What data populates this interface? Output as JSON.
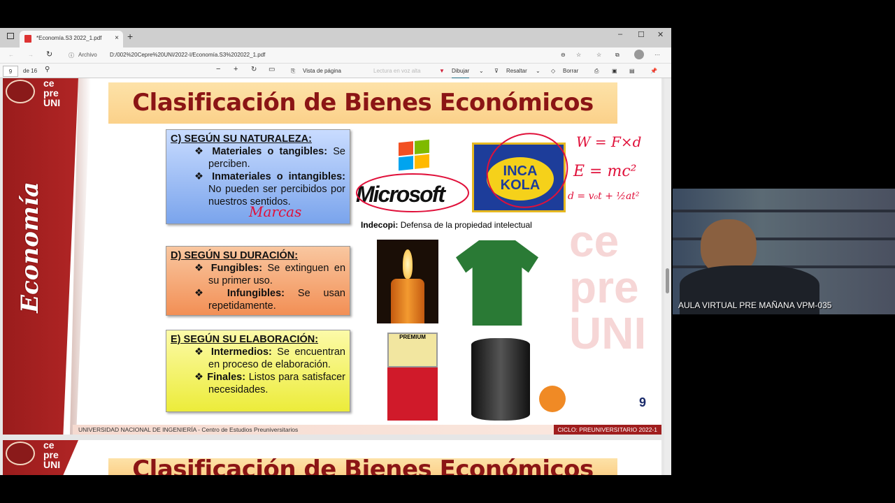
{
  "browser": {
    "tab_title": "*Economía.S3 2022_1.pdf",
    "address_prefix": "Archivo",
    "url": "D:/002%20Cepre%20UNI/2022-I/Economía.S3%202022_1.pdf"
  },
  "pdf_toolbar": {
    "page": "9",
    "of": "de 16",
    "page_view": "Vista de página",
    "read_aloud": "Lectura en voz alta",
    "draw": "Dibujar",
    "highlight": "Resaltar",
    "erase": "Borrar"
  },
  "slide": {
    "logo_text": "ce pre UNI",
    "side_title": "Economía",
    "bg_text": "ce pre UNI",
    "title": "Clasificación de Bienes Económicos",
    "c": {
      "heading": "C) SEGÚN SU NATURALEZA:",
      "i1_b": "Materiales o tangibles:",
      "i1": "Se perciben.",
      "i2_b": "Inmateriales o intangibles:",
      "i2": "No pueden ser percibidos por nuestros sentidos."
    },
    "d": {
      "heading": "D) SEGÚN SU DURACIÓN:",
      "i1_b": "Fungibles:",
      "i1": "Se extinguen en su primer uso.",
      "i2_b": "Infungibles:",
      "i2": "Se usan repetidamente."
    },
    "e": {
      "heading": "E) SEGÚN SU ELABORACIÓN:",
      "i1_b": "Intermedios:",
      "i1": "Se encuentran en proceso de elaboración.",
      "i2_b": "Finales:",
      "i2": "Listos para satisfacer necesidades."
    },
    "microsoft": "Microsoft",
    "inca_kola": "INCA KOLA",
    "pump_label": "PREMIUM",
    "indecopi_b": "Indecopi:",
    "indecopi": "Defensa de la propiedad intelectual",
    "handwriting": {
      "marcas": "Marcas",
      "w": "W = F×d",
      "e": "E = mc²",
      "d": "d = v₀t + ½at²"
    },
    "page_number": "9",
    "footer_left": "UNIVERSIDAD NACIONAL DE INGENIERÍA - Centro de Estudios Preuniversitarios",
    "footer_right": "CICLO: PREUNIVERSITARIO 2022-1"
  },
  "video": {
    "label": "AULA VIRTUAL PRE MAÑANA VPM-035"
  }
}
